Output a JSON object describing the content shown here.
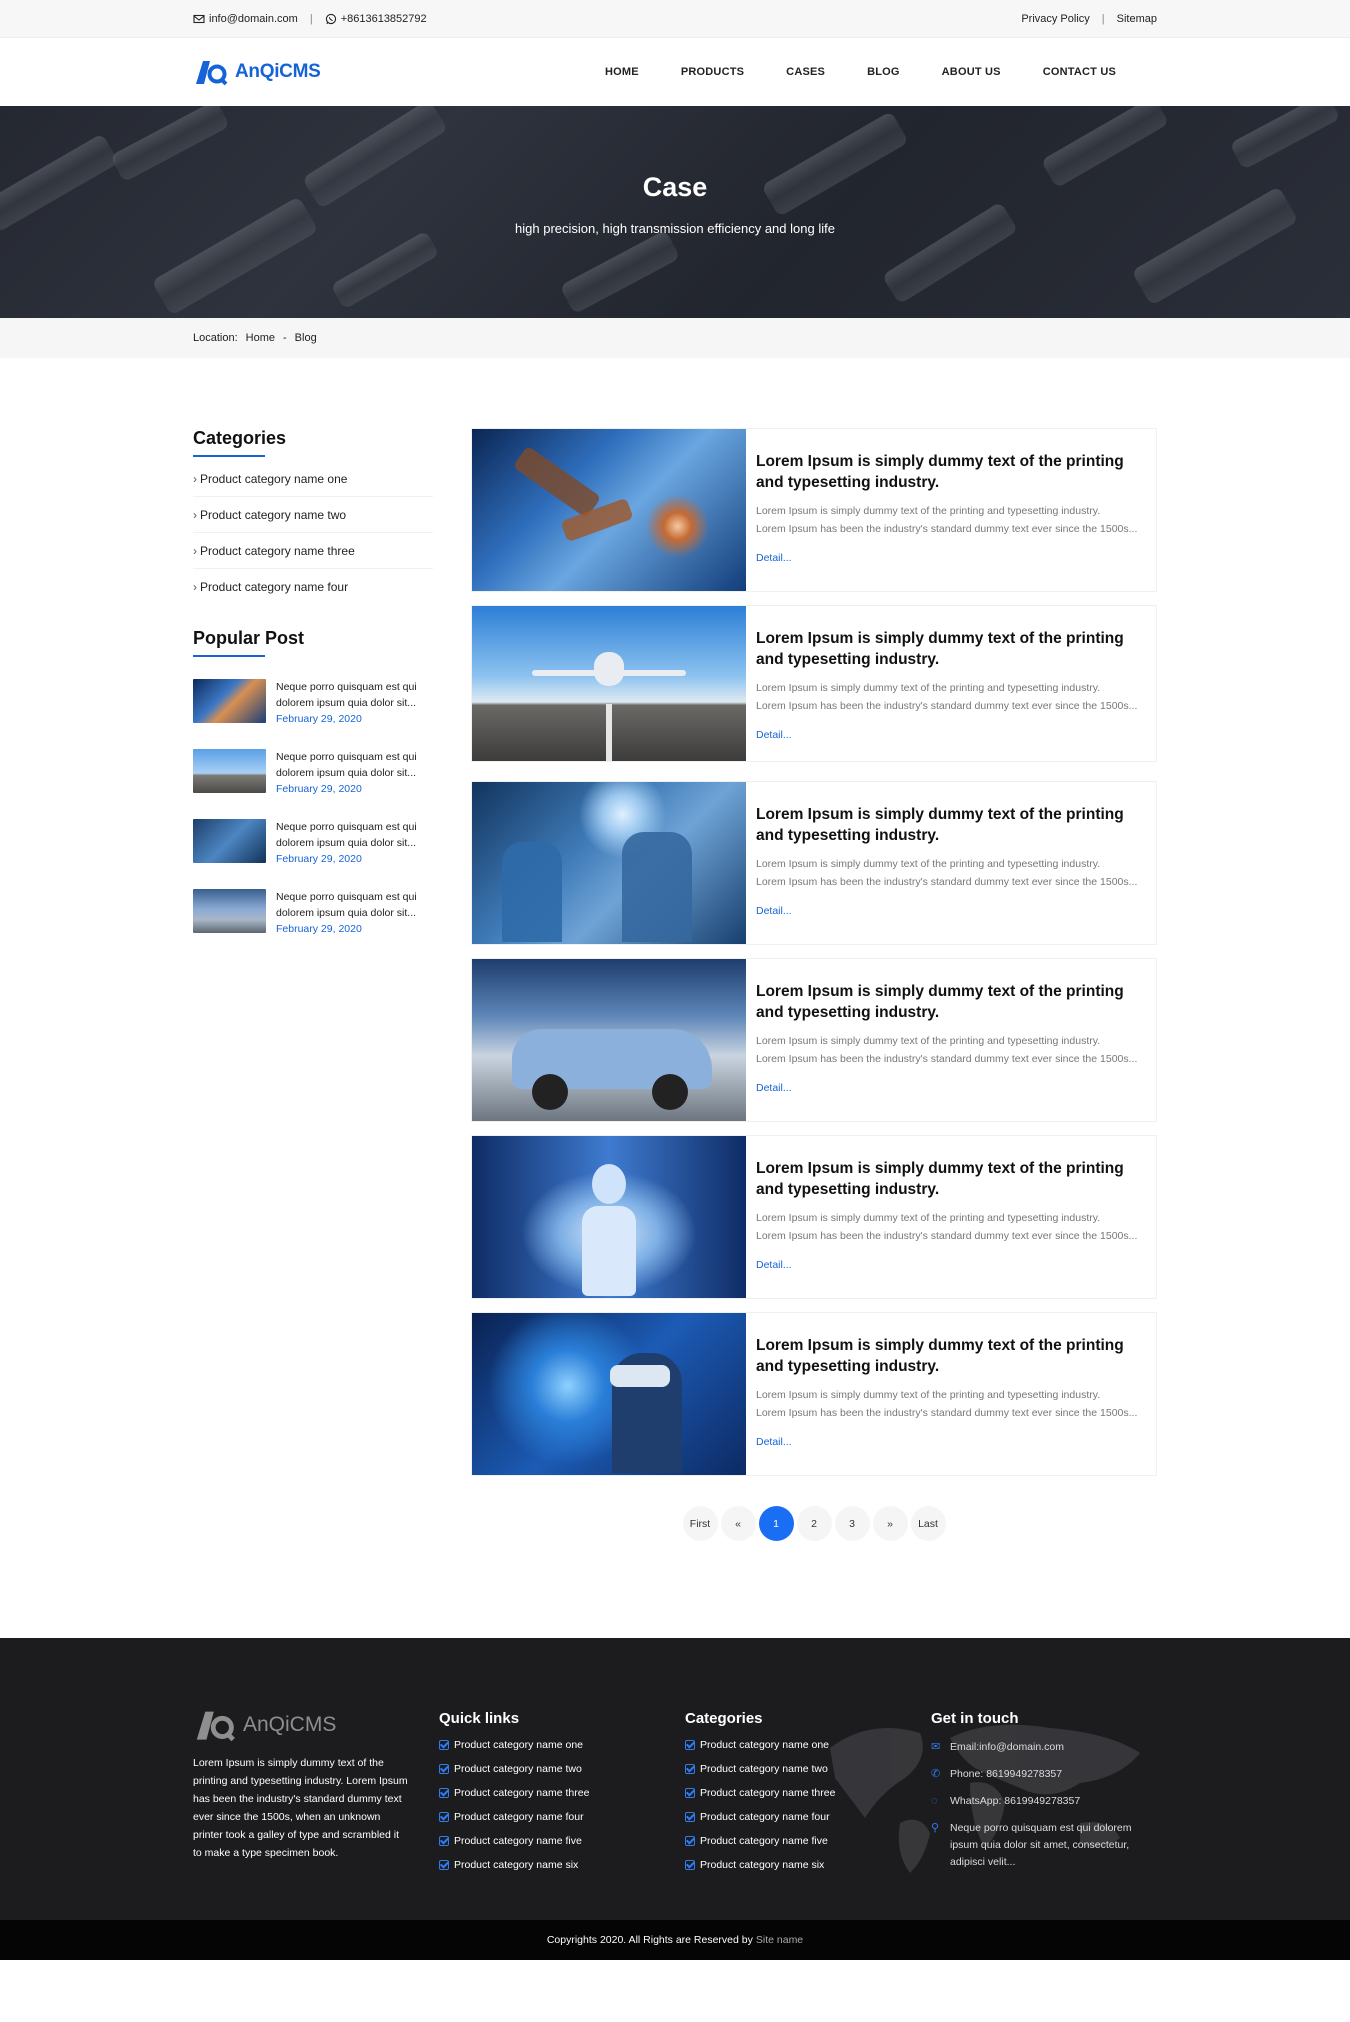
{
  "topbar": {
    "email": "info@domain.com",
    "phone": "+8613613852792",
    "privacy": "Privacy Policy",
    "sitemap": "Sitemap",
    "separator": "|"
  },
  "header": {
    "logo_text": "AnQiCMS",
    "nav": [
      "HOME",
      "PRODUCTS",
      "CASES",
      "BLOG",
      "ABOUT US",
      "CONTACT US"
    ]
  },
  "banner": {
    "title": "Case",
    "subtitle": "high precision, high transmission efficiency and long life"
  },
  "breadcrumb": {
    "label": "Location:",
    "home": "Home",
    "sep": "-",
    "current": "Blog"
  },
  "sidebar": {
    "categories_title": "Categories",
    "categories": [
      "Product category name one",
      "Product category name two",
      "Product category name three",
      "Product category name four"
    ],
    "popular_title": "Popular Post",
    "popular": [
      {
        "text": "Neque porro quisquam est qui dolorem ipsum quia dolor sit...",
        "date": "February 29, 2020",
        "thumb": "factory"
      },
      {
        "text": "Neque porro quisquam est qui dolorem ipsum quia dolor sit...",
        "date": "February 29, 2020",
        "thumb": "plane"
      },
      {
        "text": "Neque porro quisquam est qui dolorem ipsum quia dolor sit...",
        "date": "February 29, 2020",
        "thumb": "surgery"
      },
      {
        "text": "Neque porro quisquam est qui dolorem ipsum quia dolor sit...",
        "date": "February 29, 2020",
        "thumb": "car"
      }
    ]
  },
  "posts": [
    {
      "title": "Lorem Ipsum is simply dummy text of the printing and typesetting industry.",
      "line1": "Lorem Ipsum is simply dummy text of the printing and typesetting industry.",
      "line2": "Lorem Ipsum has been the industry's standard dummy text ever since the 1500s...",
      "more": "Detail...",
      "image": "robot-arm"
    },
    {
      "title": "Lorem Ipsum is simply dummy text of the printing and typesetting industry.",
      "line1": "Lorem Ipsum is simply dummy text of the printing and typesetting industry.",
      "line2": "Lorem Ipsum has been the industry's standard dummy text ever since the 1500s...",
      "more": "Detail...",
      "image": "airplane"
    },
    {
      "title": "Lorem Ipsum is simply dummy text of the printing and typesetting industry.",
      "line1": "Lorem Ipsum is simply dummy text of the printing and typesetting industry.",
      "line2": "Lorem Ipsum has been the industry's standard dummy text ever since the 1500s...",
      "more": "Detail...",
      "image": "surgery"
    },
    {
      "title": "Lorem Ipsum is simply dummy text of the printing and typesetting industry.",
      "line1": "Lorem Ipsum is simply dummy text of the printing and typesetting industry.",
      "line2": "Lorem Ipsum has been the industry's standard dummy text ever since the 1500s...",
      "more": "Detail...",
      "image": "car"
    },
    {
      "title": "Lorem Ipsum is simply dummy text of the printing and typesetting industry.",
      "line1": "Lorem Ipsum is simply dummy text of the printing and typesetting industry.",
      "line2": "Lorem Ipsum has been the industry's standard dummy text ever since the 1500s...",
      "more": "Detail...",
      "image": "humanoid-robot"
    },
    {
      "title": "Lorem Ipsum is simply dummy text of the printing and typesetting industry.",
      "line1": "Lorem Ipsum is simply dummy text of the printing and typesetting industry.",
      "line2": "Lorem Ipsum has been the industry's standard dummy text ever since the 1500s...",
      "more": "Detail...",
      "image": "vr-headset"
    }
  ],
  "pagination": {
    "first": "First",
    "prev": "«",
    "pages": [
      "1",
      "2",
      "3"
    ],
    "active": "1",
    "next": "»",
    "last": "Last"
  },
  "footer": {
    "logo_text": "AnQiCMS",
    "about": "Lorem Ipsum is simply dummy text of the printing and typesetting industry. Lorem Ipsum has been the industry's standard dummy text ever since the 1500s, when an unknown printer took a galley of type and scrambled it to make a type specimen book.",
    "quick_links_title": "Quick links",
    "quick_links": [
      "Product category name one",
      "Product category name two",
      "Product category name three",
      "Product category name four",
      "Product category name five",
      "Product category name six"
    ],
    "categories_title": "Categories",
    "categories": [
      "Product category name one",
      "Product category name two",
      "Product category name three",
      "Product category name four",
      "Product category name five",
      "Product category name six"
    ],
    "contact_title": "Get in touch",
    "email": "Email:info@domain.com",
    "phone": "Phone: 8619949278357",
    "whatsapp": "WhatsApp: 8619949278357",
    "address": "Neque porro quisquam est qui dolorem ipsum quia dolor sit amet, consectetur, adipisci velit...",
    "copyright": "Copyrights 2020. All Rights are Reserved by",
    "site_name": "Site name"
  },
  "colors": {
    "accent": "#1663d8",
    "footer_bg": "#1c1c1e",
    "copyright_bg": "#050505"
  }
}
